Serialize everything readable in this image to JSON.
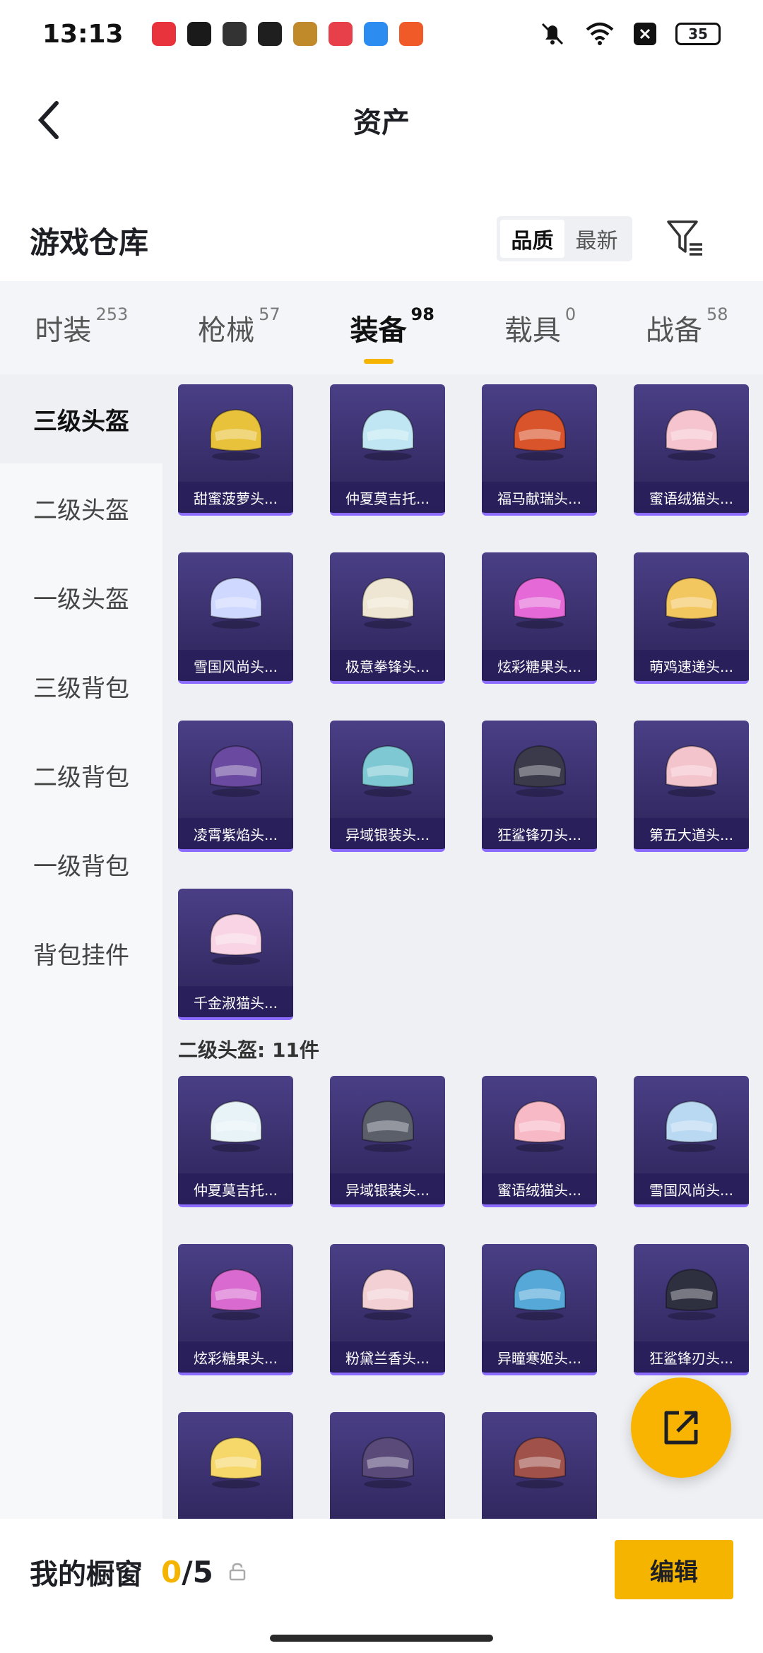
{
  "status_bar": {
    "time": "13:13",
    "battery": "35",
    "app_icons": [
      "music-app-icon",
      "shield-app-icon",
      "text-app-icon",
      "chat-app-icon",
      "game-app-icon",
      "video-app-icon",
      "browser-app-icon",
      "map-app-icon"
    ],
    "app_colors": [
      "#e8323c",
      "#1a1a1a",
      "#333333",
      "#1f1f1f",
      "#c08a2a",
      "#e8404a",
      "#2d8cf0",
      "#f05a28"
    ]
  },
  "header": {
    "title": "资产",
    "back_icon": "chevron-left-icon"
  },
  "warehouse": {
    "title": "游戏仓库",
    "sort_options": [
      "品质",
      "最新"
    ],
    "sort_selected": "品质",
    "filter_icon": "filter-icon"
  },
  "tabs": [
    {
      "label": "时装",
      "count": "253",
      "active": false
    },
    {
      "label": "枪械",
      "count": "57",
      "active": false
    },
    {
      "label": "装备",
      "count": "98",
      "active": true
    },
    {
      "label": "载具",
      "count": "0",
      "active": false
    },
    {
      "label": "战备",
      "count": "58",
      "active": false
    }
  ],
  "sidebar": {
    "items": [
      "三级头盔",
      "二级头盔",
      "一级头盔",
      "三级背包",
      "二级背包",
      "一级背包",
      "背包挂件"
    ],
    "active": "三级头盔"
  },
  "sections": [
    {
      "heading": "",
      "items": [
        {
          "name": "甜蜜菠萝头...",
          "color": "#e8c23a"
        },
        {
          "name": "仲夏莫吉托...",
          "color": "#bfe6f2"
        },
        {
          "name": "福马献瑞头...",
          "color": "#d9532b"
        },
        {
          "name": "蜜语绒猫头...",
          "color": "#f6c4cf"
        },
        {
          "name": "雪国风尚头...",
          "color": "#cfd8ff"
        },
        {
          "name": "极意拳锋头...",
          "color": "#eee6d2"
        },
        {
          "name": "炫彩糖果头...",
          "color": "#e56ad8"
        },
        {
          "name": "萌鸡速递头...",
          "color": "#f3c760"
        },
        {
          "name": "凌霄紫焰头...",
          "color": "#6a4aa0"
        },
        {
          "name": "异域银装头...",
          "color": "#7ec8d4"
        },
        {
          "name": "狂鲨锋刃头...",
          "color": "#3a3a4a"
        },
        {
          "name": "第五大道头...",
          "color": "#f4c4cc"
        },
        {
          "name": "千金淑猫头...",
          "color": "#f8d4e4"
        }
      ]
    },
    {
      "heading": "二级头盔: 11件",
      "items": [
        {
          "name": "仲夏莫吉托...",
          "color": "#e8f3f7"
        },
        {
          "name": "异域银装头...",
          "color": "#5a5f6a"
        },
        {
          "name": "蜜语绒猫头...",
          "color": "#f7b9c6"
        },
        {
          "name": "雪国风尚头...",
          "color": "#b9d8f2"
        },
        {
          "name": "炫彩糖果头...",
          "color": "#d86ad0"
        },
        {
          "name": "粉黛兰香头...",
          "color": "#f3d0d4"
        },
        {
          "name": "异瞳寒姬头...",
          "color": "#55a8d8"
        },
        {
          "name": "狂鲨锋刃头...",
          "color": "#2e3040"
        },
        {
          "name": "",
          "color": "#f6d76a"
        },
        {
          "name": "",
          "color": "#5a4a7a"
        },
        {
          "name": "",
          "color": "#a0524a"
        }
      ]
    }
  ],
  "fab": {
    "icon": "share-external-icon"
  },
  "showcase": {
    "title": "我的橱窗",
    "current": "0",
    "slash": "/",
    "max": "5",
    "lock_icon": "lock-icon",
    "edit_label": "编辑"
  },
  "colors": {
    "accent": "#f5b400",
    "card_bg": "#3a2f72"
  }
}
